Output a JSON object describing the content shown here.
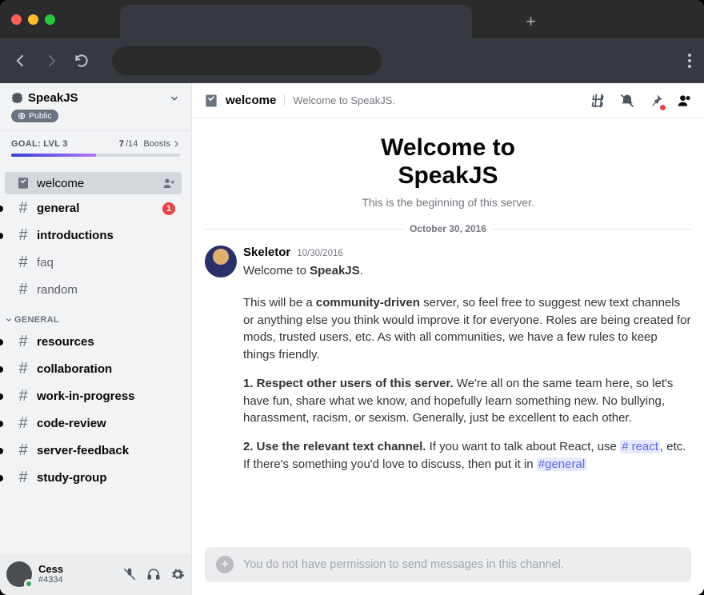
{
  "browser": {
    "newtab_glyph": "+"
  },
  "server": {
    "name": "SpeakJS",
    "public_label": "Public",
    "boost": {
      "goal_label": "GOAL: LVL 3",
      "count_current": "7",
      "count_total": "/14",
      "boosts_label": "Boosts"
    }
  },
  "sidebar": {
    "top": [
      {
        "name": "welcome",
        "icon": "rules",
        "selected": true,
        "adduser": true
      },
      {
        "name": "general",
        "icon": "hash",
        "unread": true,
        "mention": "1"
      },
      {
        "name": "introductions",
        "icon": "hash",
        "unread": true
      },
      {
        "name": "faq",
        "icon": "hash"
      },
      {
        "name": "random",
        "icon": "hash"
      }
    ],
    "category": "GENERAL",
    "general": [
      {
        "name": "resources",
        "icon": "hash",
        "unread": true
      },
      {
        "name": "collaboration",
        "icon": "hash",
        "unread": true
      },
      {
        "name": "work-in-progress",
        "icon": "hash",
        "unread": true
      },
      {
        "name": "code-review",
        "icon": "hash",
        "unread": true
      },
      {
        "name": "server-feedback",
        "icon": "hash",
        "unread": true
      },
      {
        "name": "study-group",
        "icon": "hash",
        "unread": true
      }
    ]
  },
  "user": {
    "name": "Cess",
    "tag": "#4334"
  },
  "channel": {
    "name": "welcome",
    "topic": "Welcome to SpeakJS."
  },
  "welcome": {
    "title_l1": "Welcome to",
    "title_l2": "SpeakJS",
    "subtitle": "This is the beginning of this server.",
    "divider_date": "October 30, 2016"
  },
  "message": {
    "author": "Skeletor",
    "timestamp": "10/30/2016",
    "intro_prefix": "Welcome to ",
    "intro_bold": "SpeakJS",
    "intro_suffix": ".",
    "p1_a": "This will be a ",
    "p1_bold": "community-driven",
    "p1_b": " server, so feel free to suggest new text channels or anything else you think would improve it for everyone. Roles are being created for mods, trusted users, etc. As with all communities, we have a few rules to keep things friendly.",
    "r1_bold": "1. Respect other users of this server.",
    "r1_text": " We're all on the same team here, so let's have fun, share what we know, and hopefully learn something new. No bullying, harassment, racism, or sexism. Generally, just be excellent to each other.",
    "r2_bold": "2. Use the relevant text channel.",
    "r2_a": " If you want to talk about React, use ",
    "r2_m1": "# react",
    "r2_b": ", etc. If there's something you'd love to discuss, then put it in ",
    "r2_m2": "#general"
  },
  "composer": {
    "placeholder": "You do not have permission to send messages in this channel."
  }
}
